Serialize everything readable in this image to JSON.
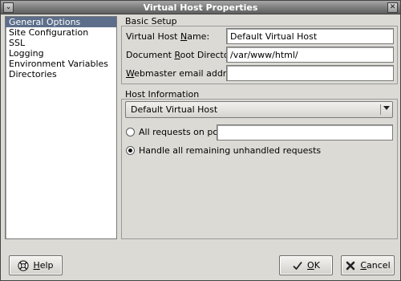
{
  "window": {
    "title": "Virtual Host Properties"
  },
  "sidebar": {
    "items": [
      {
        "label": "General Options"
      },
      {
        "label": "Site Configuration"
      },
      {
        "label": "SSL"
      },
      {
        "label": "Logging"
      },
      {
        "label": "Environment Variables"
      },
      {
        "label": "Directories"
      }
    ],
    "selected_item": "General Options"
  },
  "basic_setup": {
    "title": "Basic Setup",
    "vhost_name": {
      "label_pre": "Virtual Host ",
      "label_u": "N",
      "label_post": "ame:",
      "value": "Default Virtual Host"
    },
    "doc_root": {
      "label_pre": "Document ",
      "label_u": "R",
      "label_post": "oot Directory:",
      "value": "/var/www/html/"
    },
    "webmaster": {
      "label_pre": "",
      "label_u": "W",
      "label_post": "ebmaster email address:",
      "value": ""
    }
  },
  "host_info": {
    "title": "Host Information",
    "combo_value": "Default Virtual Host",
    "radio_all_requests": {
      "label": "All requests on port:",
      "selected": false,
      "port_value": ""
    },
    "radio_unhandled": {
      "label": "Handle all remaining unhandled requests",
      "selected": true
    }
  },
  "buttons": {
    "help": {
      "label_u": "H",
      "label_post": "elp"
    },
    "ok": {
      "label_u": "O",
      "label_post": "K"
    },
    "cancel": {
      "label_u": "C",
      "label_post": "ancel"
    }
  },
  "icons": {
    "window_menu": "chevron-down-icon",
    "window_close": "close-icon",
    "help": "help-lifebuoy-icon",
    "ok": "checkmark-icon",
    "cancel": "cross-icon"
  }
}
